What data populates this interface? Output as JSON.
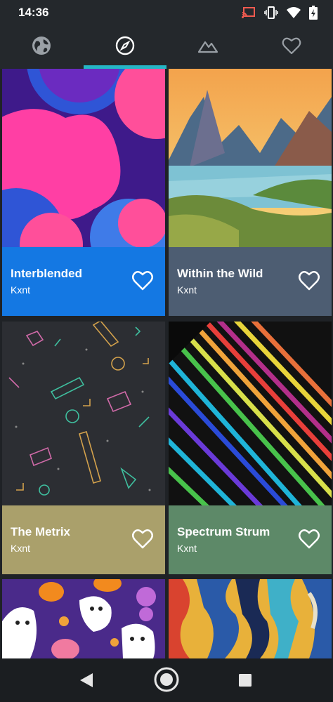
{
  "status_bar": {
    "time": "14:36",
    "icons": [
      "cast-icon",
      "vibrate-icon",
      "wifi-icon",
      "battery-charging-icon"
    ]
  },
  "tabs": [
    {
      "name": "tab-explore",
      "icon": "globe-icon",
      "selected": false
    },
    {
      "name": "tab-discover",
      "icon": "compass-icon",
      "selected": true
    },
    {
      "name": "tab-collections",
      "icon": "mountain-icon",
      "selected": false
    },
    {
      "name": "tab-favorites",
      "icon": "heart-icon",
      "selected": false
    }
  ],
  "colors": {
    "accent": "#25b6c6",
    "card_1_footer": "#1478e3",
    "card_2_footer": "#4d5d72",
    "card_3_footer": "#aaa06b",
    "card_4_footer": "#5d8968"
  },
  "wallpapers": [
    {
      "title": "Interblended",
      "author": "Kxnt"
    },
    {
      "title": "Within the Wild",
      "author": "Kxnt"
    },
    {
      "title": "The Metrix",
      "author": "Kxnt"
    },
    {
      "title": "Spectrum Strum",
      "author": "Kxnt"
    }
  ],
  "nav_bar": [
    "back-icon",
    "home-icon",
    "recents-icon"
  ]
}
